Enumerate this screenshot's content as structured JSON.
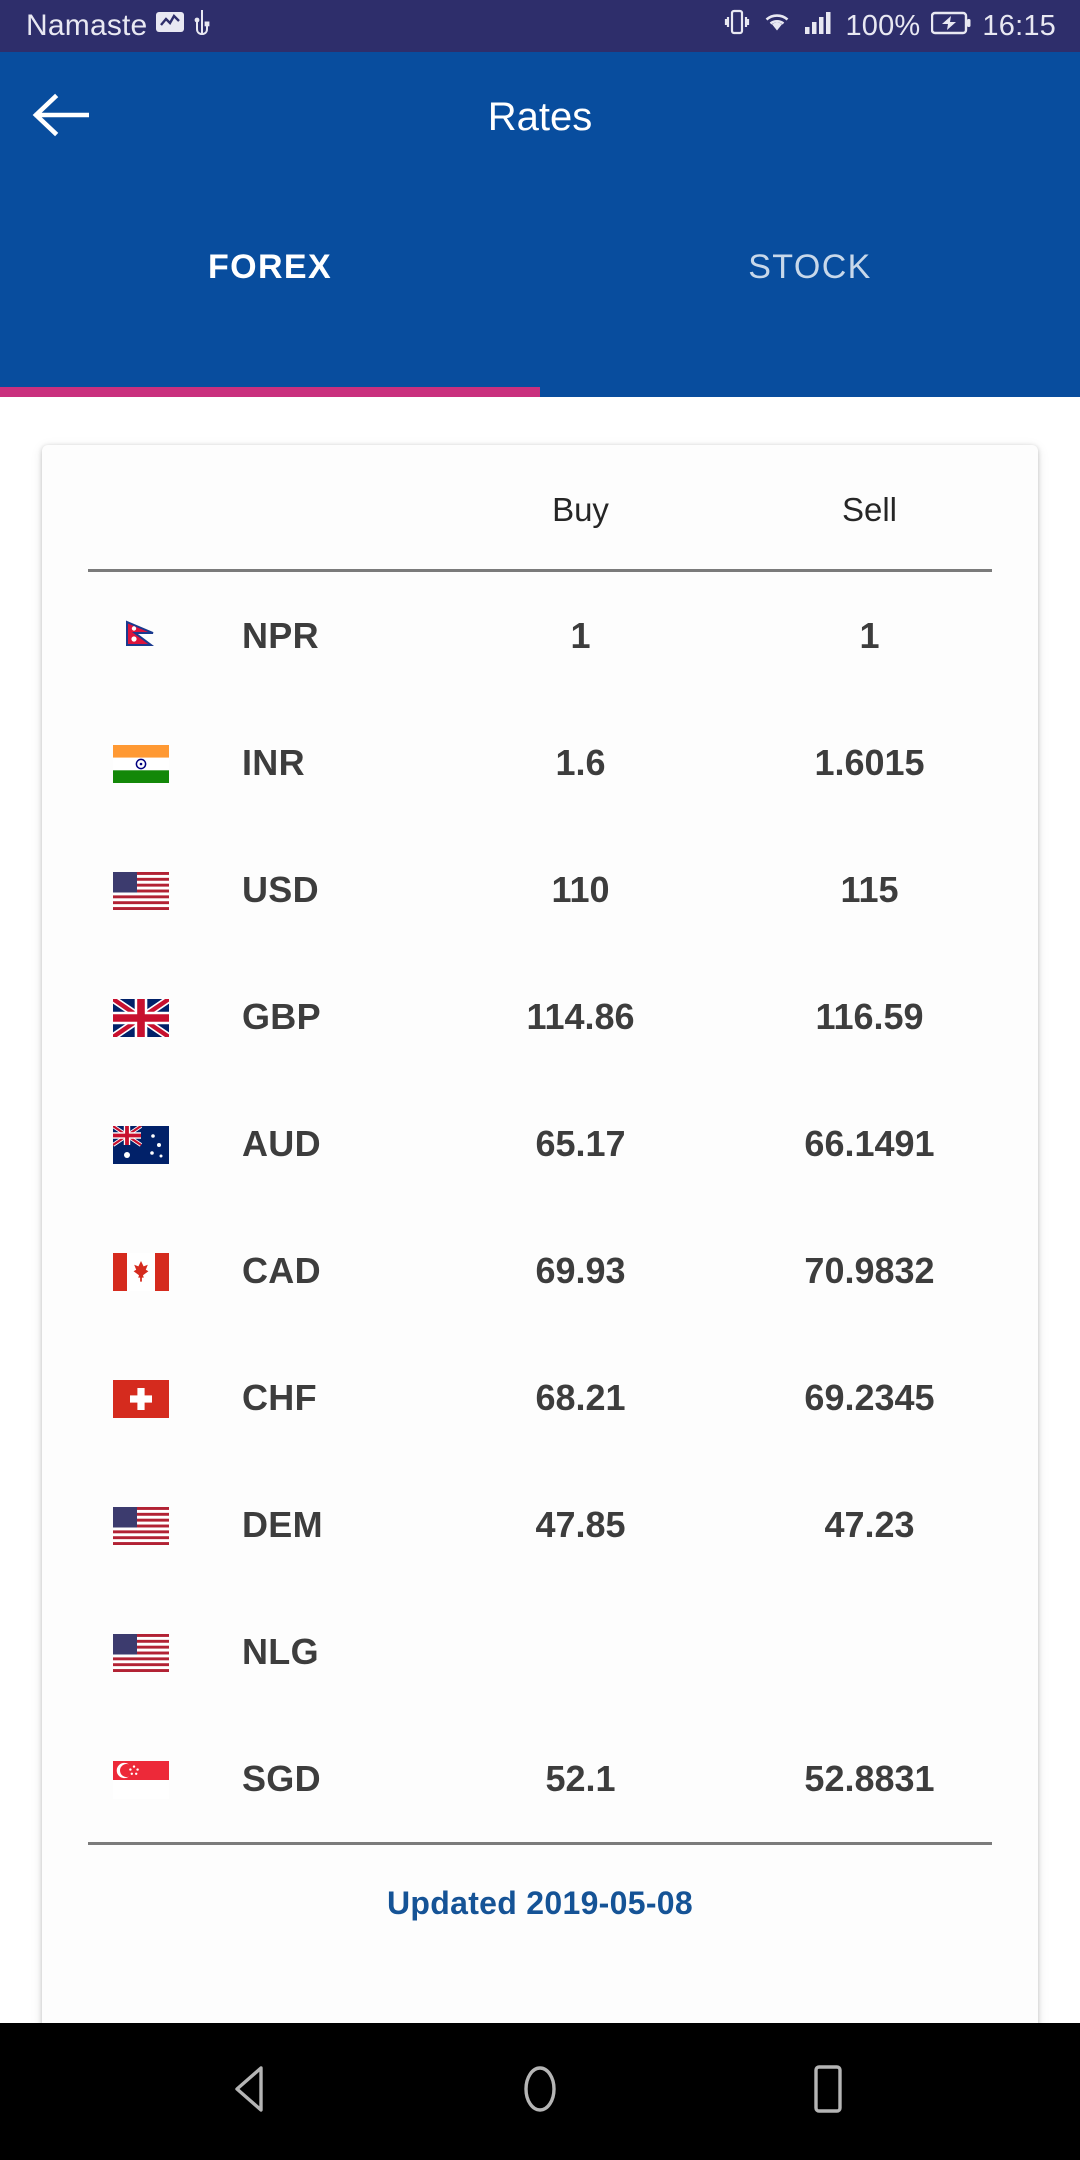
{
  "status_bar": {
    "carrier": "Namaste",
    "signal_icon": "signal-activity-icon",
    "usb_icon": "usb-icon",
    "vibrate_icon": "vibrate-icon",
    "wifi_icon": "wifi-icon",
    "cellular_icon": "cellular-signal-icon",
    "battery_percent": "100%",
    "battery_icon": "battery-charging-icon",
    "time": "16:15"
  },
  "app_bar": {
    "back_icon": "back-arrow-icon",
    "title": "Rates"
  },
  "tabs": [
    {
      "label": "FOREX",
      "active": true
    },
    {
      "label": "STOCK",
      "active": false
    }
  ],
  "table": {
    "columns": [
      "",
      "",
      "Buy",
      "Sell"
    ],
    "header_buy": "Buy",
    "header_sell": "Sell",
    "rows": [
      {
        "flag": "nepal-flag-icon",
        "code": "NPR",
        "buy": "1",
        "sell": "1"
      },
      {
        "flag": "india-flag-icon",
        "code": "INR",
        "buy": "1.6",
        "sell": "1.6015"
      },
      {
        "flag": "usa-flag-icon",
        "code": "USD",
        "buy": "110",
        "sell": "115"
      },
      {
        "flag": "uk-flag-icon",
        "code": "GBP",
        "buy": "114.86",
        "sell": "116.59"
      },
      {
        "flag": "australia-flag-icon",
        "code": "AUD",
        "buy": "65.17",
        "sell": "66.1491"
      },
      {
        "flag": "canada-flag-icon",
        "code": "CAD",
        "buy": "69.93",
        "sell": "70.9832"
      },
      {
        "flag": "switzerland-flag-icon",
        "code": "CHF",
        "buy": "68.21",
        "sell": "69.2345"
      },
      {
        "flag": "usa-flag-icon",
        "code": "DEM",
        "buy": "47.85",
        "sell": "47.23"
      },
      {
        "flag": "usa-flag-icon",
        "code": "NLG",
        "buy": "",
        "sell": ""
      },
      {
        "flag": "singapore-flag-icon",
        "code": "SGD",
        "buy": "52.1",
        "sell": "52.8831"
      }
    ],
    "updated_label": "Updated 2019-05-08"
  },
  "nav_bar": {
    "back": "nav-back-icon",
    "home": "nav-home-icon",
    "recents": "nav-recents-icon"
  },
  "colors": {
    "status_bar_bg": "#2e2e6b",
    "app_bar_bg": "#084d9e",
    "tab_indicator": "#c9307e",
    "updated_text": "#155396",
    "nav_bar_bg": "#000000"
  }
}
